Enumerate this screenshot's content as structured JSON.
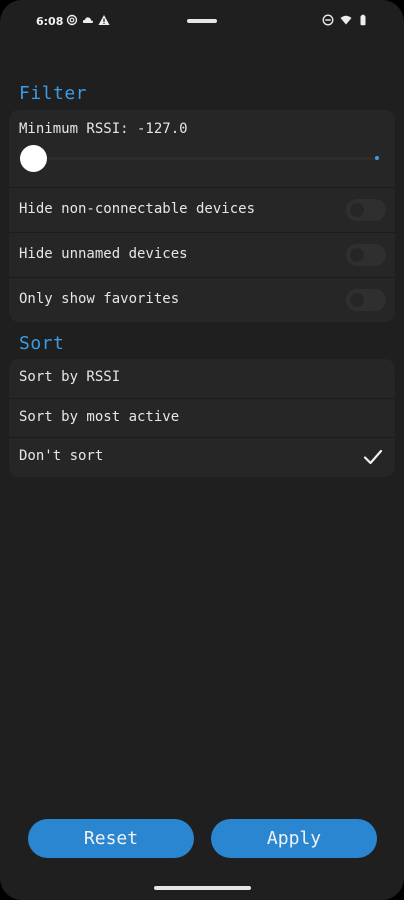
{
  "status_bar": {
    "time": "6:08",
    "left_icons": [
      "at-sign-icon",
      "cloud-icon",
      "warning-icon"
    ],
    "right_icons": [
      "do-not-disturb-icon",
      "wifi-icon",
      "battery-icon"
    ]
  },
  "filter": {
    "title": "Filter",
    "rssi_label": "Minimum RSSI: -127.0",
    "rssi_slider_fraction": 0.0,
    "toggles": [
      {
        "label": "Hide non-connectable devices",
        "checked": false
      },
      {
        "label": "Hide unnamed devices",
        "checked": false
      },
      {
        "label": "Only show favorites",
        "checked": false
      }
    ]
  },
  "sort": {
    "title": "Sort",
    "options": [
      {
        "label": "Sort by RSSI",
        "selected": false
      },
      {
        "label": "Sort by most active",
        "selected": false
      },
      {
        "label": "Don't sort",
        "selected": true
      }
    ]
  },
  "buttons": {
    "reset_label": "Reset",
    "apply_label": "Apply"
  },
  "colors": {
    "accent": "#3d9be3",
    "button": "#2a86d0",
    "background": "#1f1f1f",
    "card": "#262626"
  }
}
